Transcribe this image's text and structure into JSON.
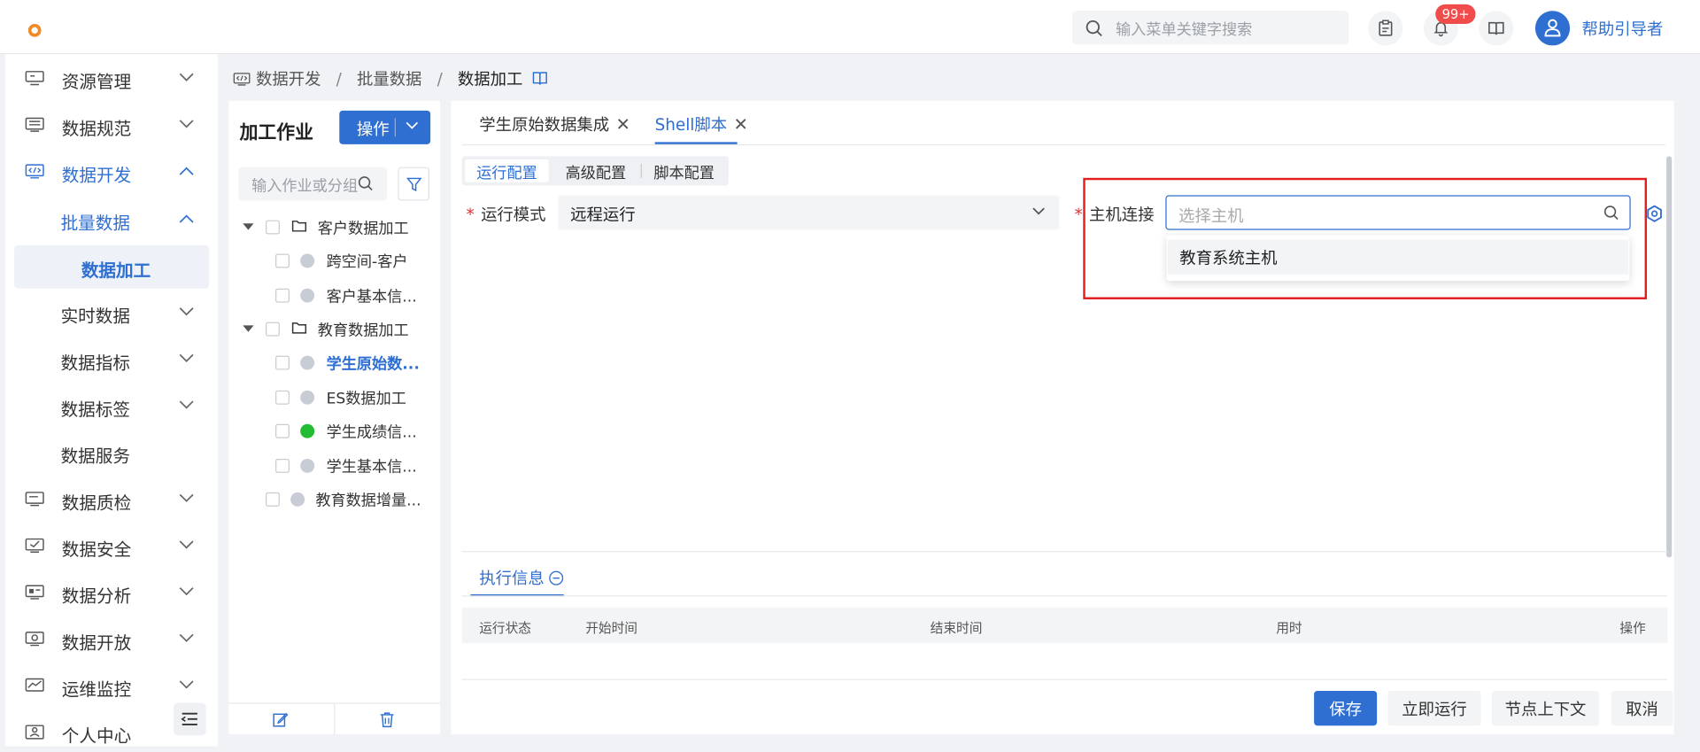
{
  "header": {
    "search_placeholder": "输入菜单关键字搜索",
    "notification_count": "99+",
    "username": "帮助引导者"
  },
  "sidebar": {
    "items": [
      {
        "label": "资源管理",
        "icon": "server-icon"
      },
      {
        "label": "数据规范",
        "icon": "document-icon"
      },
      {
        "label": "数据开发",
        "icon": "code-icon"
      },
      {
        "label": "批量数据"
      },
      {
        "label": "数据加工"
      },
      {
        "label": "实时数据"
      },
      {
        "label": "数据指标"
      },
      {
        "label": "数据标签"
      },
      {
        "label": "数据服务"
      },
      {
        "label": "数据质检",
        "icon": "monitor-icon"
      },
      {
        "label": "数据安全",
        "icon": "check-monitor-icon"
      },
      {
        "label": "数据分析",
        "icon": "analysis-icon"
      },
      {
        "label": "数据开放",
        "icon": "open-icon"
      },
      {
        "label": "运维监控",
        "icon": "chart-icon"
      },
      {
        "label": "个人中心",
        "icon": "user-card-icon"
      }
    ]
  },
  "breadcrumb": {
    "items": [
      "数据开发",
      "批量数据",
      "数据加工"
    ],
    "separator": "/"
  },
  "tree_panel": {
    "title": "加工作业",
    "op_button": "操作",
    "search_placeholder": "输入作业或分组",
    "nodes": [
      {
        "label": "客户数据加工",
        "type": "folder"
      },
      {
        "label": "跨空间-客户",
        "type": "job",
        "status": "idle"
      },
      {
        "label": "客户基本信...",
        "type": "job",
        "status": "idle"
      },
      {
        "label": "教育数据加工",
        "type": "folder"
      },
      {
        "label": "学生原始数...",
        "type": "job",
        "status": "idle",
        "selected": true
      },
      {
        "label": "ES数据加工",
        "type": "job",
        "status": "idle"
      },
      {
        "label": "学生成绩信...",
        "type": "job",
        "status": "success"
      },
      {
        "label": "学生基本信...",
        "type": "job",
        "status": "idle"
      },
      {
        "label": "教育数据增量...",
        "type": "job",
        "status": "idle"
      }
    ]
  },
  "tabs": [
    {
      "label": "学生原始数据集成",
      "active": false
    },
    {
      "label": "Shell脚本",
      "active": true
    }
  ],
  "config_tabs": [
    "运行配置",
    "高级配置",
    "脚本配置"
  ],
  "form": {
    "run_mode_label": "运行模式",
    "run_mode_value": "远程运行",
    "host_label": "主机连接",
    "host_placeholder": "选择主机",
    "host_options": [
      "教育系统主机"
    ]
  },
  "exec_info": {
    "title": "执行信息",
    "columns": [
      "运行状态",
      "开始时间",
      "结束时间",
      "用时",
      "操作"
    ]
  },
  "footer_buttons": {
    "save": "保存",
    "run_now": "立即运行",
    "node_context": "节点上下文",
    "cancel": "取消"
  },
  "colors": {
    "accent": "#2f6fd1",
    "highlight_box": "#e02020",
    "badge": "#f04c4c",
    "success": "#22bb33"
  }
}
